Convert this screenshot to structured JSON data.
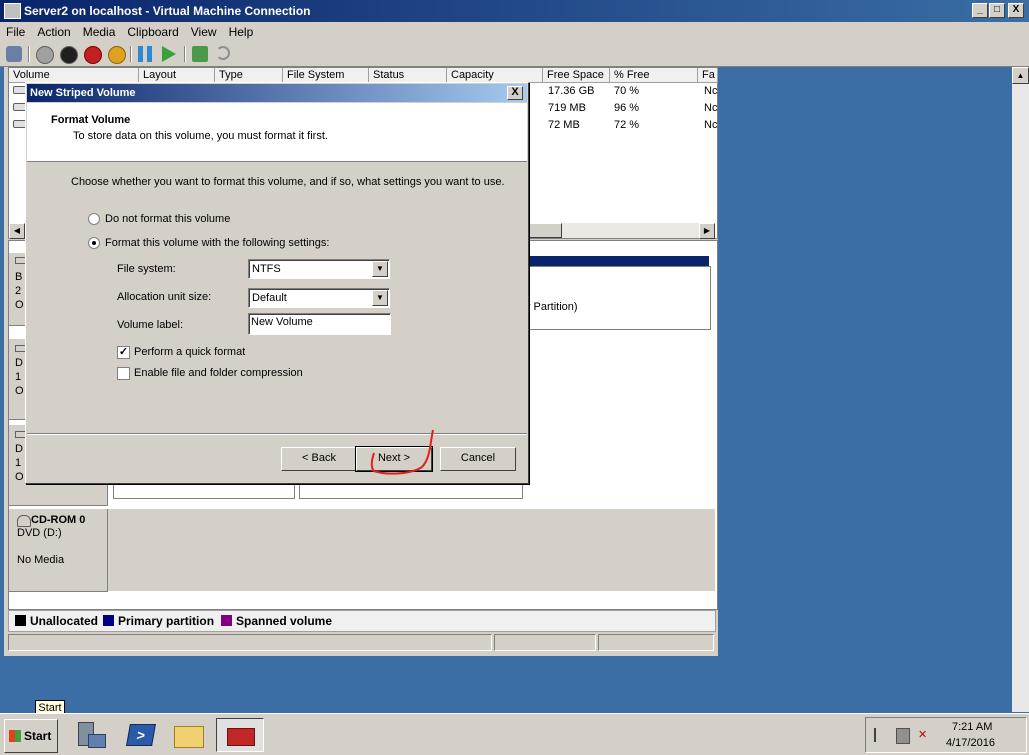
{
  "vm_window": {
    "title": "Server2 on localhost - Virtual Machine Connection",
    "controls": {
      "minimize": "_",
      "maximize": "□",
      "close": "X"
    }
  },
  "menu": [
    "File",
    "Action",
    "Media",
    "Clipboard",
    "View",
    "Help"
  ],
  "volume_list": {
    "columns": [
      "Volume",
      "Layout",
      "Type",
      "File System",
      "Status",
      "Capacity",
      "Free Space",
      "% Free",
      "Fa"
    ],
    "rows": [
      {
        "free_space": "17.36 GB",
        "pct_free": "70 %",
        "fa": "Nc"
      },
      {
        "free_space": "719 MB",
        "pct_free": "96 %",
        "fa": "Nc"
      },
      {
        "free_space": "72 MB",
        "pct_free": "72 %",
        "fa": "Nc"
      }
    ]
  },
  "graph": {
    "partition_fragment": "y Partition)",
    "disk_fragments": [
      {
        "l1": "B",
        "l2": "2",
        "l3": "O"
      },
      {
        "l1": "D",
        "l2": "1",
        "l3": "O"
      },
      {
        "l1": "D",
        "l2": "1",
        "l3": "O"
      }
    ],
    "cdrom": {
      "name": "CD-ROM 0",
      "drive": "DVD (D:)",
      "media": "No Media"
    }
  },
  "legend": [
    {
      "label": "Unallocated",
      "color": "#000000"
    },
    {
      "label": "Primary partition",
      "color": "#000080"
    },
    {
      "label": "Spanned volume",
      "color": "#800080"
    }
  ],
  "dialog": {
    "title": "New Striped Volume",
    "close": "X",
    "heading": "Format Volume",
    "subheading": "To store data on this volume, you must format it first.",
    "instruction": "Choose whether you want to format this volume, and if so, what settings you want to use.",
    "option_no_format": "Do not format this volume",
    "option_format": "Format this volume with the following settings:",
    "file_system_label": "File system:",
    "file_system_value": "NTFS",
    "allocation_label": "Allocation unit size:",
    "allocation_value": "Default",
    "volume_label_label": "Volume label:",
    "volume_label_value": "New Volume",
    "quick_format": "Perform a quick format",
    "compression": "Enable file and folder compression",
    "quick_format_checked": true,
    "compression_checked": false,
    "back": "< Back",
    "next": "Next >",
    "cancel": "Cancel"
  },
  "taskbar": {
    "start": "Start",
    "tooltip": "Start",
    "time": "7:21 AM",
    "date": "4/17/2016"
  },
  "annotation_color": "#e0201a"
}
